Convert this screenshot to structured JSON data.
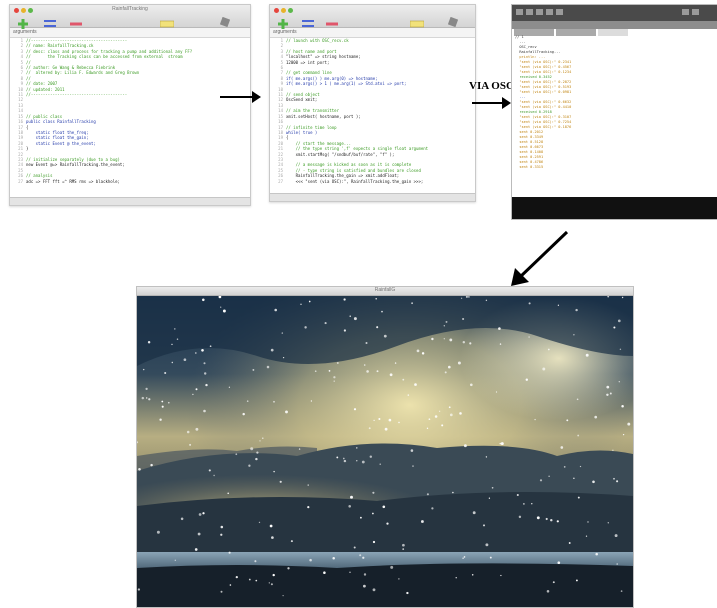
{
  "window1": {
    "title": "RainfallTracking",
    "args_label": "arguments",
    "lines": [
      {
        "n": "1",
        "cls": "c",
        "text": "//----------------------------------------"
      },
      {
        "n": "2",
        "cls": "c",
        "text": "// name: RainfallTracking.ck"
      },
      {
        "n": "3",
        "cls": "c",
        "text": "// desc: class and process for tracking a pump and additional any FF?"
      },
      {
        "n": "4",
        "cls": "c",
        "text": "//       the Tracking class can be accessed from external  stream"
      },
      {
        "n": "5",
        "cls": "c",
        "text": "//"
      },
      {
        "n": "6",
        "cls": "c",
        "text": "// author: Ge Wang & Rebecca Fiebrink"
      },
      {
        "n": "7",
        "cls": "c",
        "text": "//  altered by: Lilia F. Edwards and Greg Brown"
      },
      {
        "n": "8",
        "cls": "c",
        "text": "//"
      },
      {
        "n": "9",
        "cls": "c",
        "text": "// date: 2007"
      },
      {
        "n": "10",
        "cls": "c",
        "text": "// updated: 2011"
      },
      {
        "n": "11",
        "cls": "c",
        "text": "//----------------------------------------"
      },
      {
        "n": "12",
        "cls": "t",
        "text": ""
      },
      {
        "n": "13",
        "cls": "t",
        "text": ""
      },
      {
        "n": "14",
        "cls": "t",
        "text": ""
      },
      {
        "n": "15",
        "cls": "c",
        "text": "// public class"
      },
      {
        "n": "16",
        "cls": "k",
        "text": "public class RainfallTracking"
      },
      {
        "n": "17",
        "cls": "t",
        "text": "{"
      },
      {
        "n": "18",
        "cls": "k",
        "text": "    static float the_freq;"
      },
      {
        "n": "19",
        "cls": "k",
        "text": "    static float the_gain;"
      },
      {
        "n": "20",
        "cls": "k",
        "text": "    static Event @ the_event;"
      },
      {
        "n": "21",
        "cls": "t",
        "text": "}"
      },
      {
        "n": "22",
        "cls": "t",
        "text": ""
      },
      {
        "n": "23",
        "cls": "c",
        "text": "// initialize separately (due to a bug)"
      },
      {
        "n": "24",
        "cls": "t",
        "text": "new Event @=> RainfallTracking.the_event;"
      },
      {
        "n": "25",
        "cls": "t",
        "text": ""
      },
      {
        "n": "26",
        "cls": "c",
        "text": "// analysis"
      },
      {
        "n": "27",
        "cls": "t",
        "text": "adc => FFT fft =^ RMS rms => blackhole;"
      }
    ]
  },
  "window2": {
    "title": "",
    "args_label": "arguments",
    "lines": [
      {
        "n": "1",
        "cls": "c",
        "text": "// launch with OSC_recv.ck"
      },
      {
        "n": "2",
        "cls": "t",
        "text": ""
      },
      {
        "n": "3",
        "cls": "c",
        "text": "// host name and port"
      },
      {
        "n": "4",
        "cls": "t",
        "text": "\"localhost\" => string hostname;"
      },
      {
        "n": "5",
        "cls": "t",
        "text": "12000 => int port;"
      },
      {
        "n": "6",
        "cls": "t",
        "text": ""
      },
      {
        "n": "7",
        "cls": "c",
        "text": "// get command line"
      },
      {
        "n": "8",
        "cls": "k",
        "text": "if( me.args() ) me.arg(0) => hostname;"
      },
      {
        "n": "9",
        "cls": "k",
        "text": "if( me.args() > 1 ) me.arg(1) => Std.atoi => port;"
      },
      {
        "n": "10",
        "cls": "t",
        "text": ""
      },
      {
        "n": "11",
        "cls": "c",
        "text": "// send object"
      },
      {
        "n": "12",
        "cls": "t",
        "text": "OscSend xmit;"
      },
      {
        "n": "13",
        "cls": "t",
        "text": ""
      },
      {
        "n": "14",
        "cls": "c",
        "text": "// aim the transmitter"
      },
      {
        "n": "15",
        "cls": "t",
        "text": "xmit.setHost( hostname, port );"
      },
      {
        "n": "16",
        "cls": "t",
        "text": ""
      },
      {
        "n": "17",
        "cls": "c",
        "text": "// infinite time loop"
      },
      {
        "n": "18",
        "cls": "k",
        "text": "while( true )"
      },
      {
        "n": "19",
        "cls": "t",
        "text": "{"
      },
      {
        "n": "20",
        "cls": "c",
        "text": "    // start the message..."
      },
      {
        "n": "21",
        "cls": "c",
        "text": "    // the type string ',f' expects a single float argument"
      },
      {
        "n": "22",
        "cls": "t",
        "text": "    xmit.startMsg( \"/sndbuf/buf/rate\", \"f\" );"
      },
      {
        "n": "23",
        "cls": "t",
        "text": ""
      },
      {
        "n": "24",
        "cls": "c",
        "text": "    // a message is kicked as soon as it is complete"
      },
      {
        "n": "25",
        "cls": "c",
        "text": "    // - type string is satisfied and bundles are closed"
      },
      {
        "n": "26",
        "cls": "t",
        "text": "    RainfallTracking.the_gain => xmit.addFloat;"
      },
      {
        "n": "27",
        "cls": "t",
        "text": "    <<< \"sent (via OSC):\", RainfallTracking.the_gain >>>;"
      }
    ]
  },
  "osc_label": "VIA OSC",
  "monitor": {
    "lines": [
      {
        "cls": "d",
        "text": "// 1"
      },
      {
        "cls": "d",
        "text": "  ..."
      },
      {
        "cls": "d",
        "text": "  OSC_recv"
      },
      {
        "cls": "d",
        "text": "  RainfallTracking..."
      },
      {
        "cls": "y",
        "text": "  println: ..."
      },
      {
        "cls": "y",
        "text": "  \"sent (via OSC):\" 0.2341"
      },
      {
        "cls": "y",
        "text": "  \"sent (via OSC):\" 0.4567"
      },
      {
        "cls": "y",
        "text": "  \"sent (via OSC):\" 0.1234"
      },
      {
        "cls": "g",
        "text": "  received 0.3452"
      },
      {
        "cls": "y",
        "text": "  \"sent (via OSC):\" 0.2872"
      },
      {
        "cls": "y",
        "text": "  \"sent (via OSC):\" 0.5193"
      },
      {
        "cls": "y",
        "text": "  \"sent (via OSC):\" 0.0981"
      },
      {
        "cls": "b",
        "text": "  ..."
      },
      {
        "cls": "y",
        "text": "  \"sent (via OSC):\" 0.6632"
      },
      {
        "cls": "y",
        "text": "  \"sent (via OSC):\" 0.4410"
      },
      {
        "cls": "g",
        "text": "  received 0.2918"
      },
      {
        "cls": "y",
        "text": "  \"sent (via OSC):\" 0.3107"
      },
      {
        "cls": "y",
        "text": "  \"sent (via OSC):\" 0.7254"
      },
      {
        "cls": "y",
        "text": "  \"sent (via OSC):\" 0.1876"
      },
      {
        "cls": "d",
        "text": ""
      },
      {
        "cls": "y",
        "text": "  sent 0.2012"
      },
      {
        "cls": "y",
        "text": "  sent 0.3349"
      },
      {
        "cls": "y",
        "text": "  sent 0.5128"
      },
      {
        "cls": "y",
        "text": "  sent 0.6673"
      },
      {
        "cls": "y",
        "text": "  sent 0.1408"
      },
      {
        "cls": "y",
        "text": "  sent 0.2591"
      },
      {
        "cls": "y",
        "text": "  sent 0.4786"
      },
      {
        "cls": "y",
        "text": "  sent 0.3315"
      }
    ]
  },
  "photo_window": {
    "title": "RainfallG"
  }
}
